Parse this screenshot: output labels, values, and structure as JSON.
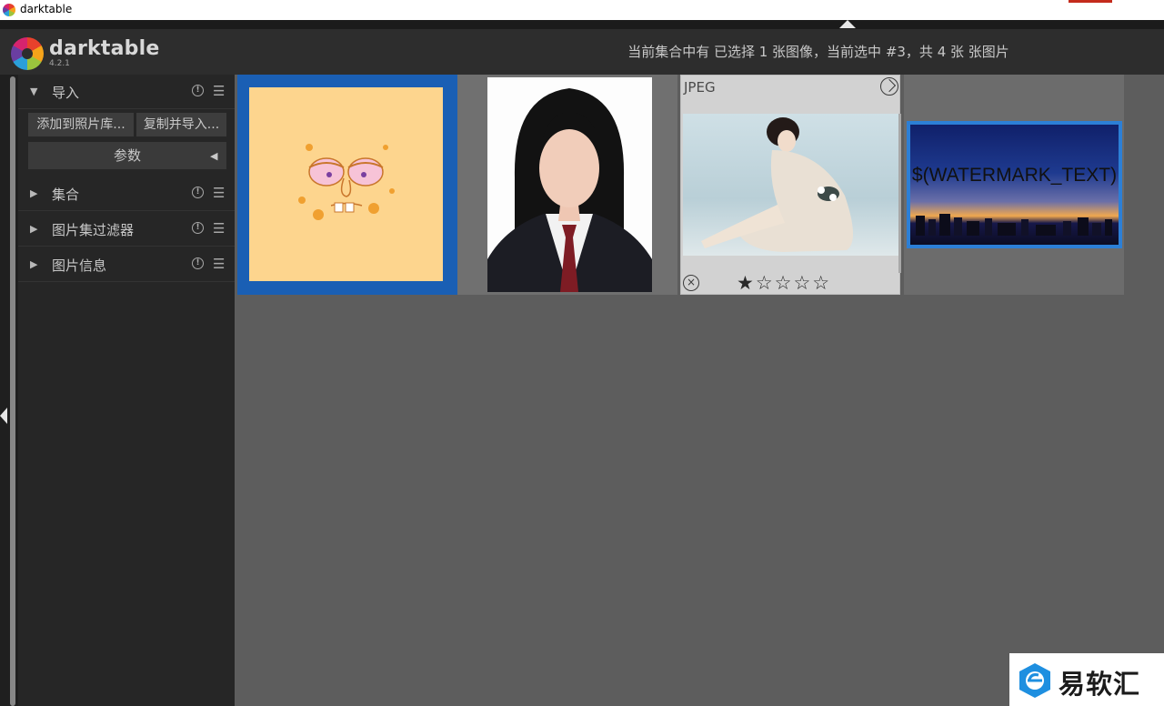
{
  "window": {
    "title": "darktable"
  },
  "header": {
    "logo_name": "darktable",
    "version": "4.2.1",
    "selection_status": "当前集合中有 已选择 1 张图像，当前选中 #3，共 4 张 张图片"
  },
  "left_panel": {
    "modules": [
      {
        "label": "导入",
        "expanded": true
      },
      {
        "label": "集合",
        "expanded": false
      },
      {
        "label": "图片集过滤器",
        "expanded": false
      },
      {
        "label": "图片信息",
        "expanded": false
      }
    ],
    "import": {
      "add_to_library": "添加到照片库...",
      "copy_and_import": "复制并导入...",
      "parameters": "参数"
    }
  },
  "thumbnails": [
    {
      "name": "spongebob-face",
      "selected": true
    },
    {
      "name": "id-portrait",
      "selected": false
    },
    {
      "name": "seated-woman",
      "selected": false,
      "format": "JPEG",
      "rating": 1,
      "max_rating": 5,
      "stars": "★☆☆☆☆"
    },
    {
      "name": "city-skyline",
      "selected": true,
      "watermark_text": "$(WATERMARK_TEXT)"
    }
  ],
  "colors": {
    "selection": "#1a5fb4",
    "accent": "#2c7fd6",
    "background": "#5d5d5d",
    "panel": "#262626"
  },
  "brand": {
    "text": "易软汇"
  }
}
